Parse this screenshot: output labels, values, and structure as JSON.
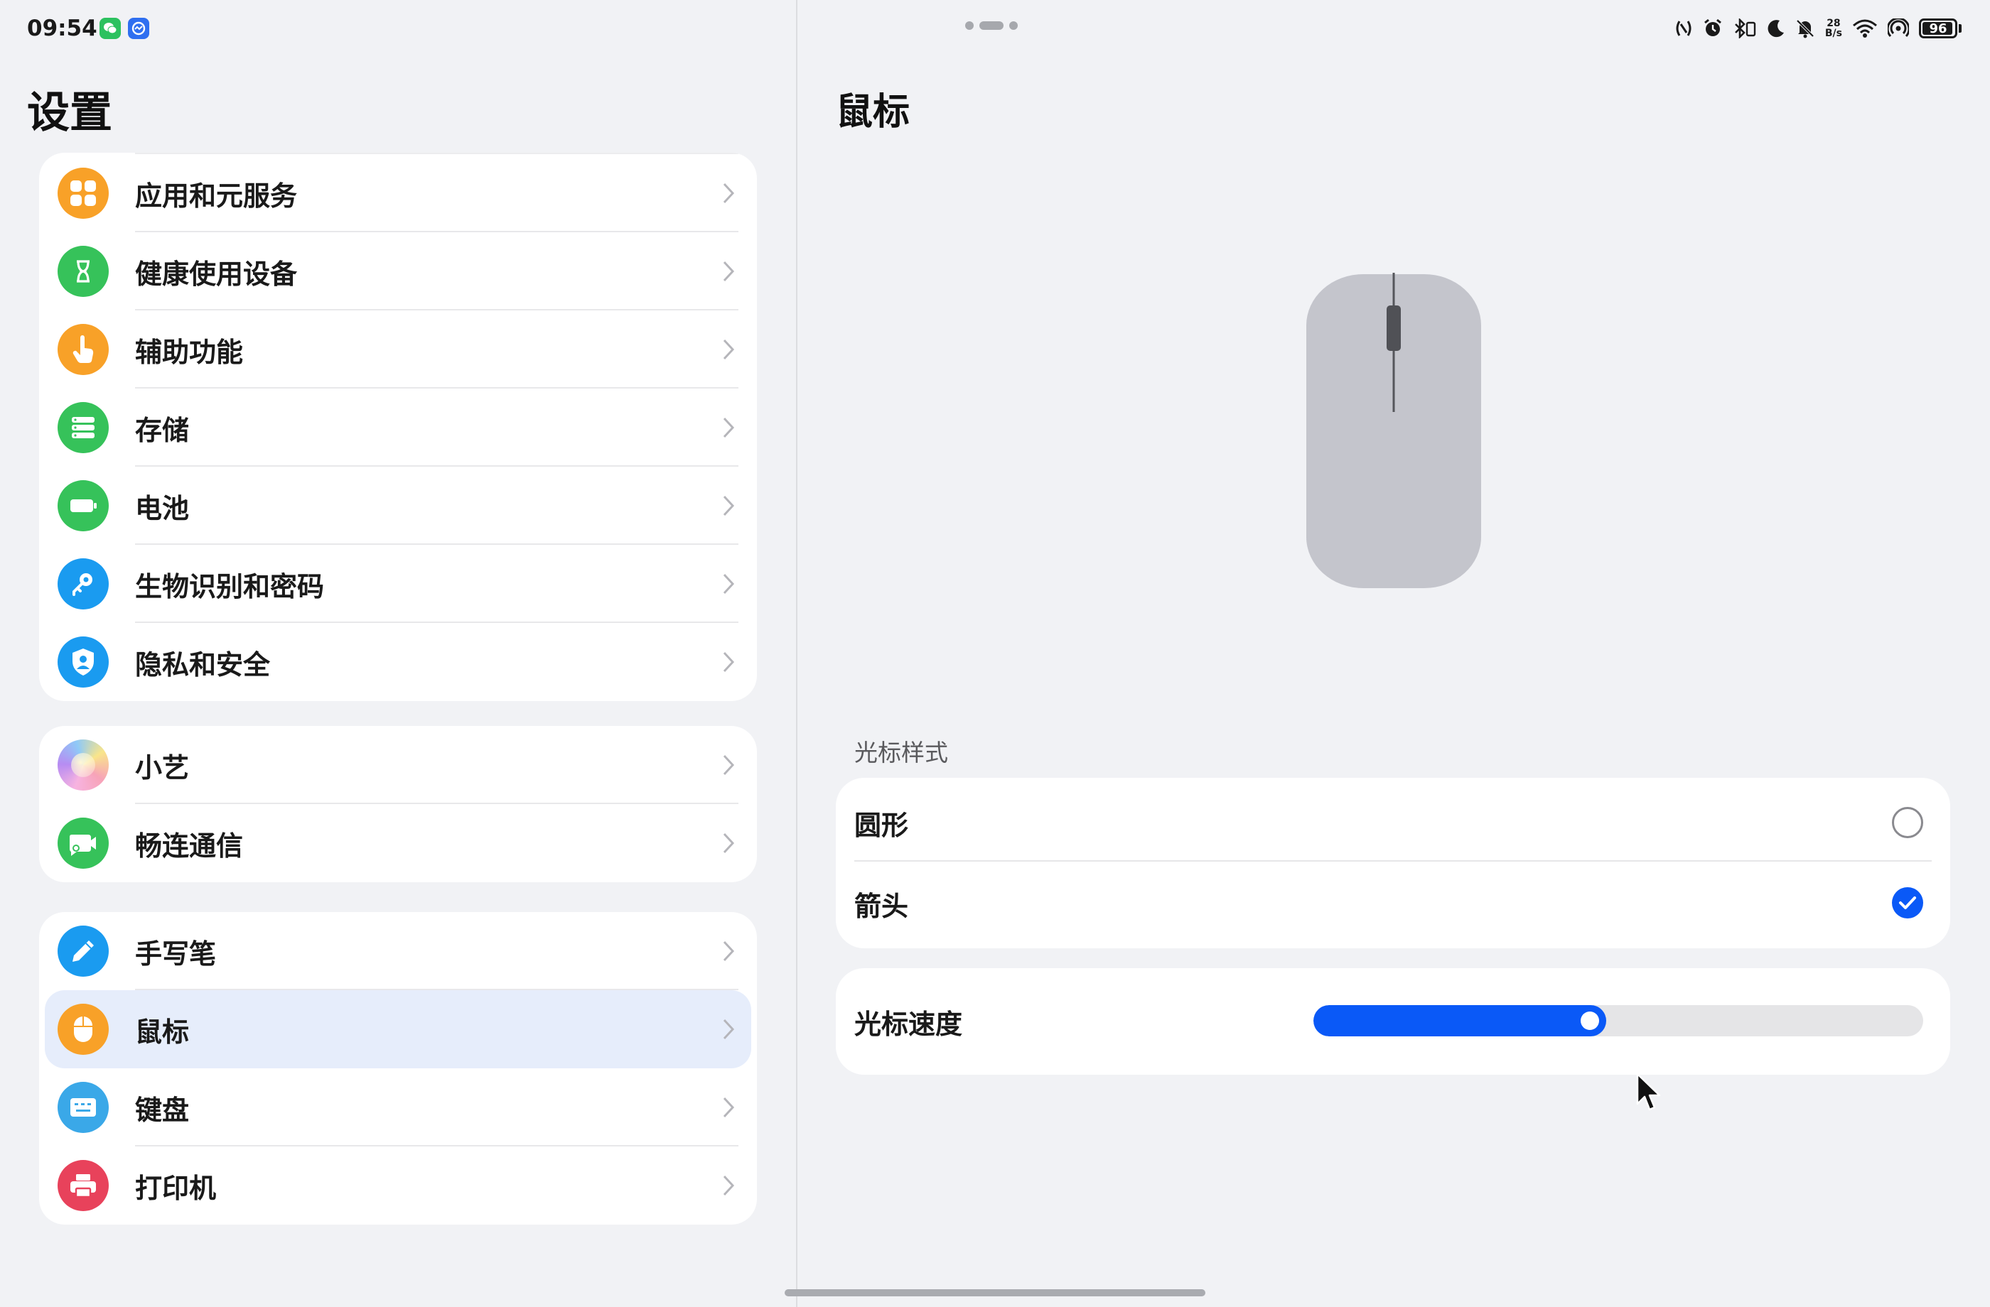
{
  "status_bar": {
    "time": "09:54",
    "app_badges": [
      "wechat-icon",
      "monitor-app-icon"
    ],
    "network_speed_top": "28",
    "network_speed_bottom": "B/s",
    "battery": "96",
    "battery_level_percent": 96,
    "icons": [
      "nfc-icon",
      "alarm-icon",
      "bluetooth-icon",
      "moon-icon",
      "mute-icon",
      "wifi-icon",
      "hotspot-icon"
    ]
  },
  "left": {
    "title": "设置",
    "groups": [
      [
        {
          "label": "应用和元服务",
          "icon": "apps-icon",
          "color": "#f8a128"
        },
        {
          "label": "健康使用设备",
          "icon": "hourglass-icon",
          "color": "#36c25a"
        },
        {
          "label": "辅助功能",
          "icon": "hand-icon",
          "color": "#f8a128"
        },
        {
          "label": "存储",
          "icon": "storage-icon",
          "color": "#36c25a"
        },
        {
          "label": "电池",
          "icon": "battery-icon",
          "color": "#36c25a"
        },
        {
          "label": "生物识别和密码",
          "icon": "key-icon",
          "color": "#1a9bf0"
        },
        {
          "label": "隐私和安全",
          "icon": "shield-icon",
          "color": "#1a9bf0"
        }
      ],
      [
        {
          "label": "小艺",
          "icon": "xiaoyi-icon",
          "color": "#e9a6f2"
        },
        {
          "label": "畅连通信",
          "icon": "video-call-icon",
          "color": "#36c25a"
        }
      ],
      [
        {
          "label": "手写笔",
          "icon": "pen-icon",
          "color": "#1a9bf0"
        },
        {
          "label": "鼠标",
          "icon": "mouse-icon",
          "color": "#f8a128",
          "selected": true
        },
        {
          "label": "键盘",
          "icon": "keyboard-icon",
          "color": "#3aa8e8"
        },
        {
          "label": "打印机",
          "icon": "printer-icon",
          "color": "#e8425b"
        }
      ]
    ]
  },
  "right": {
    "title": "鼠标",
    "cursor_style_label": "光标样式",
    "options": [
      {
        "label": "圆形",
        "checked": false
      },
      {
        "label": "箭头",
        "checked": true
      }
    ],
    "speed_label": "光标速度",
    "speed_fraction": 0.48,
    "accent": "#0a59f7"
  }
}
